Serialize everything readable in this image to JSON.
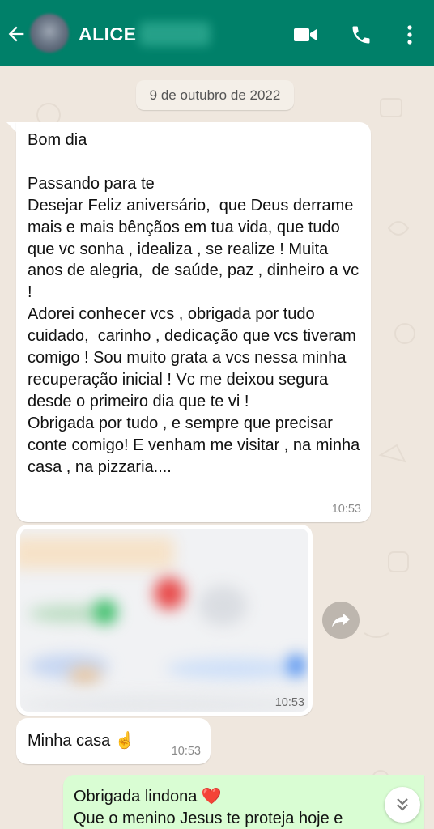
{
  "header": {
    "contact_name": "ALICE",
    "icons": [
      "back-arrow-icon",
      "video-call-icon",
      "voice-call-icon",
      "more-vert-icon"
    ],
    "color": "#008069"
  },
  "date_chip": "9 de outubro de 2022",
  "messages": [
    {
      "direction": "incoming",
      "text": "Bom dia\n\nPassando para te\nDesejar Feliz aniversário,  que Deus derrame mais e mais bênçãos em tua vida, que tudo que vc sonha , idealiza , se realize ! Muita anos de alegria,  de saúde, paz , dinheiro a vc !\nAdorei conhecer vcs , obrigada por tudo cuidado,  carinho , dedicação que vcs tiveram comigo ! Sou muito grata a vcs nessa minha recuperação inicial ! Vc me deixou segura desde o primeiro dia que te vi !\nObrigada por tudo , e sempre que precisar conte comigo! E venham me visitar , na minha casa , na pizzaria....",
      "time": "10:53"
    },
    {
      "direction": "incoming",
      "type": "image",
      "time": "10:53"
    },
    {
      "direction": "incoming",
      "text": "Minha casa ☝️",
      "time": "10:53"
    },
    {
      "direction": "outgoing",
      "text": "Obrigada lindona ❤️\nQue o menino Jesus te proteja hoje e"
    }
  ],
  "colors": {
    "incoming_bubble": "#ffffff",
    "outgoing_bubble": "#d9fdd3",
    "chat_background": "#efe7de"
  }
}
